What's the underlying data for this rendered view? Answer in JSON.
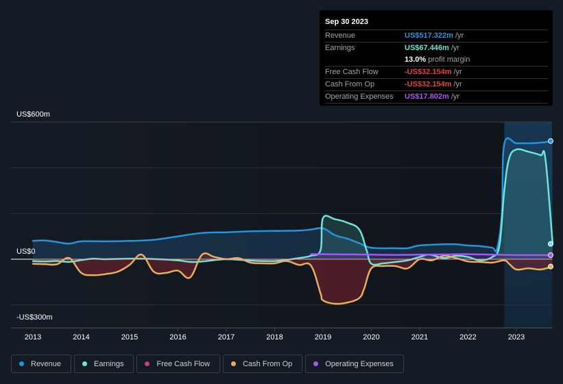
{
  "tooltip": {
    "date": "Sep 30 2023",
    "rows": [
      {
        "label": "Revenue",
        "value": "US$517.322m",
        "unit": "/yr",
        "color": "#2394df"
      },
      {
        "label": "Earnings",
        "value": "US$67.446m",
        "unit": "/yr",
        "color": "#6ce5d8"
      },
      {
        "label": "",
        "value": "13.0%",
        "unit": "profit margin",
        "color": "#ffffff"
      },
      {
        "label": "Free Cash Flow",
        "value": "-US$32.154m",
        "unit": "/yr",
        "color": "#e64141"
      },
      {
        "label": "Cash From Op",
        "value": "-US$32.154m",
        "unit": "/yr",
        "color": "#e64141"
      },
      {
        "label": "Operating Expenses",
        "value": "US$17.802m",
        "unit": "/yr",
        "color": "#a855f7"
      }
    ]
  },
  "legend": [
    {
      "label": "Revenue",
      "color": "#2394df"
    },
    {
      "label": "Earnings",
      "color": "#6ce5d8"
    },
    {
      "label": "Free Cash Flow",
      "color": "#c2417a"
    },
    {
      "label": "Cash From Op",
      "color": "#e9ae5b"
    },
    {
      "label": "Operating Expenses",
      "color": "#a855f7"
    }
  ],
  "chart_data": {
    "type": "line",
    "title": "",
    "xlabel": "",
    "ylabel": "",
    "ylim": [
      -300,
      600
    ],
    "xlim": [
      2012.95,
      2023.75
    ],
    "y_tick_labels": [
      {
        "value": 600,
        "label": "US$600m"
      },
      {
        "value": 0,
        "label": "US$0"
      },
      {
        "value": -300,
        "label": "-US$300m"
      }
    ],
    "gridlines": [
      600,
      400,
      200,
      0,
      -200,
      -300
    ],
    "x_ticks": [
      2013,
      2014,
      2015,
      2016,
      2017,
      2018,
      2019,
      2020,
      2021,
      2022,
      2023
    ],
    "highlight_start": 2022.75,
    "series": [
      {
        "name": "Revenue",
        "color": "#2394df",
        "x": [
          2013.0,
          2013.25,
          2013.5,
          2013.75,
          2014.0,
          2014.5,
          2015.0,
          2015.5,
          2016.0,
          2016.5,
          2017.0,
          2017.5,
          2018.0,
          2018.5,
          2018.75,
          2019.0,
          2019.25,
          2019.5,
          2019.75,
          2020.0,
          2020.5,
          2020.75,
          2021.0,
          2021.5,
          2021.75,
          2022.0,
          2022.25,
          2022.5,
          2022.6,
          2022.7,
          2022.75,
          2023.0,
          2023.25,
          2023.5,
          2023.75
        ],
        "y": [
          80,
          82,
          75,
          68,
          78,
          78,
          80,
          85,
          100,
          115,
          118,
          122,
          124,
          125,
          130,
          135,
          105,
          90,
          70,
          50,
          48,
          48,
          60,
          65,
          65,
          60,
          57,
          50,
          45,
          200,
          505,
          507,
          507,
          510,
          517
        ]
      },
      {
        "name": "Earnings",
        "color": "#6ce5d8",
        "x": [
          2013.0,
          2013.25,
          2013.5,
          2013.75,
          2014.0,
          2014.25,
          2014.5,
          2015.0,
          2015.5,
          2016.0,
          2016.25,
          2016.5,
          2017.0,
          2017.5,
          2018.0,
          2018.5,
          2018.75,
          2018.95,
          2019.0,
          2019.25,
          2019.5,
          2019.75,
          2019.9,
          2020.0,
          2020.25,
          2020.5,
          2020.75,
          2021.0,
          2021.2,
          2021.5,
          2021.75,
          2022.0,
          2022.25,
          2022.5,
          2022.65,
          2022.75,
          2022.85,
          2023.0,
          2023.25,
          2023.5,
          2023.6,
          2023.75
        ],
        "y": [
          -8,
          -10,
          -8,
          -12,
          -4,
          2,
          0,
          2,
          1,
          -5,
          -12,
          -10,
          0,
          -6,
          -8,
          5,
          15,
          40,
          180,
          175,
          160,
          130,
          40,
          -20,
          -18,
          -12,
          -5,
          10,
          20,
          5,
          15,
          10,
          -5,
          10,
          60,
          300,
          440,
          480,
          470,
          455,
          440,
          67
        ]
      },
      {
        "name": "Free Cash Flow",
        "color": "#c2417a",
        "x": [
          2013.0,
          2013.25,
          2013.5,
          2013.75,
          2014.0,
          2014.25,
          2014.5,
          2014.75,
          2015.0,
          2015.25,
          2015.5,
          2015.75,
          2016.0,
          2016.25,
          2016.5,
          2016.75,
          2017.0,
          2017.25,
          2017.5,
          2017.75,
          2018.0,
          2018.25,
          2018.5,
          2018.75,
          2018.95,
          2019.0,
          2019.25,
          2019.5,
          2019.75,
          2019.85,
          2020.0,
          2020.25,
          2020.5,
          2020.75,
          2021.0,
          2021.25,
          2021.5,
          2021.75,
          2022.0,
          2022.25,
          2022.5,
          2022.75,
          2022.85,
          2023.0,
          2023.25,
          2023.5,
          2023.75
        ],
        "y": [
          -20,
          -22,
          -22,
          5,
          -60,
          -70,
          -65,
          -55,
          -25,
          20,
          -55,
          -60,
          -50,
          -80,
          20,
          10,
          0,
          5,
          -15,
          -18,
          -18,
          -8,
          -25,
          -28,
          -150,
          -180,
          -195,
          -190,
          -170,
          -130,
          -40,
          -30,
          -30,
          -40,
          0,
          -5,
          15,
          5,
          -10,
          -12,
          -15,
          -5,
          -20,
          -45,
          -40,
          -45,
          -32
        ]
      },
      {
        "name": "Cash From Op",
        "color": "#e9ae5b",
        "x": [
          2013.0,
          2013.25,
          2013.5,
          2013.75,
          2014.0,
          2014.25,
          2014.5,
          2014.75,
          2015.0,
          2015.25,
          2015.5,
          2015.75,
          2016.0,
          2016.25,
          2016.5,
          2016.75,
          2017.0,
          2017.25,
          2017.5,
          2017.75,
          2018.0,
          2018.25,
          2018.5,
          2018.75,
          2018.95,
          2019.0,
          2019.25,
          2019.5,
          2019.75,
          2019.85,
          2020.0,
          2020.25,
          2020.5,
          2020.75,
          2021.0,
          2021.25,
          2021.5,
          2021.75,
          2022.0,
          2022.25,
          2022.5,
          2022.75,
          2022.85,
          2023.0,
          2023.25,
          2023.5,
          2023.75
        ],
        "y": [
          -20,
          -22,
          -22,
          5,
          -60,
          -70,
          -65,
          -55,
          -25,
          20,
          -55,
          -60,
          -50,
          -80,
          20,
          10,
          0,
          5,
          -15,
          -18,
          -18,
          -8,
          -25,
          -28,
          -150,
          -180,
          -195,
          -190,
          -170,
          -130,
          -40,
          -30,
          -30,
          -40,
          0,
          -5,
          15,
          5,
          -10,
          -12,
          -15,
          -5,
          -20,
          -45,
          -40,
          -45,
          -32
        ]
      },
      {
        "name": "Operating Expenses",
        "color": "#a855f7",
        "x": [
          2018.75,
          2019.0,
          2019.5,
          2020.0,
          2020.5,
          2021.0,
          2021.5,
          2022.0,
          2022.5,
          2022.75,
          2023.0,
          2023.5,
          2023.75
        ],
        "y": [
          22,
          22,
          21,
          20,
          19,
          20,
          21,
          22,
          20,
          19,
          18,
          18,
          17.8
        ]
      }
    ]
  }
}
